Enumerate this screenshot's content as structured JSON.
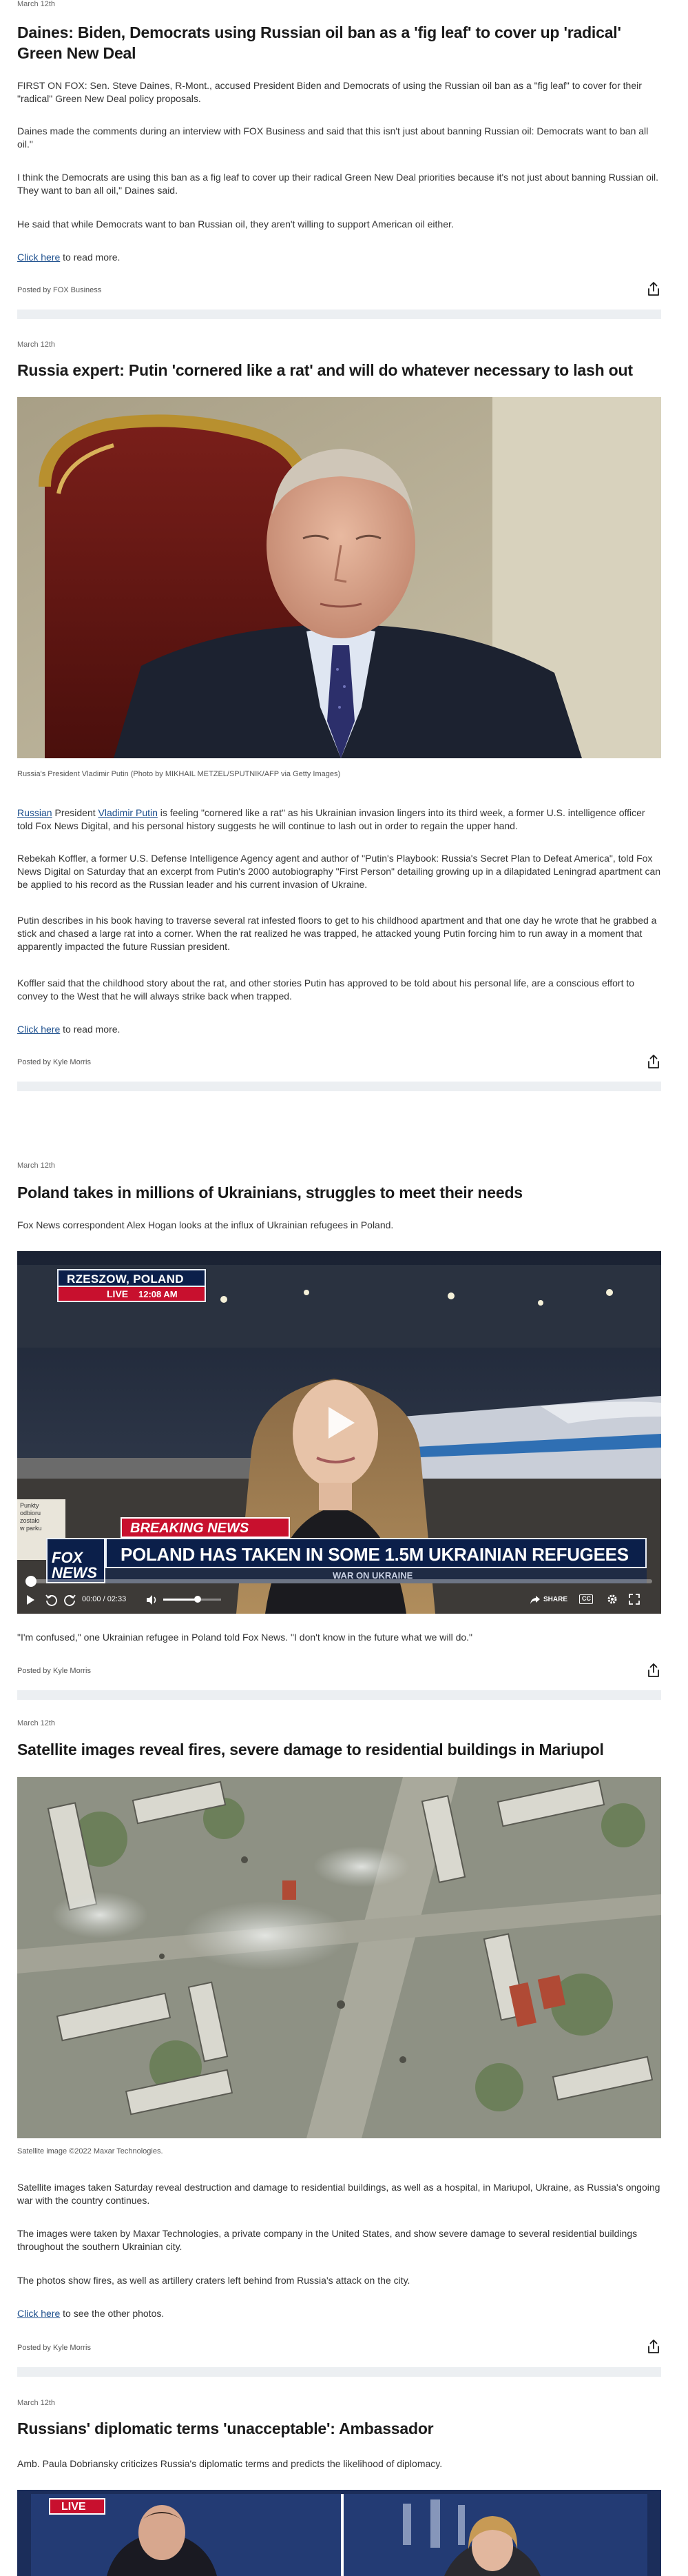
{
  "posts": [
    {
      "date": "March 12th",
      "title": "Daines: Biden, Democrats using Russian oil ban as a 'fig leaf' to cover up 'radical' Green New Deal",
      "paragraphs": [
        "FIRST ON FOX: Sen. Steve Daines, R-Mont., accused President Biden and Democrats of using the Russian oil ban as a \"fig leaf\" to cover for their \"radical\" Green New Deal policy proposals.",
        "Daines made the comments during an interview with FOX Business and said that this isn't just about banning Russian oil: Democrats want to ban all oil.\"",
        "I think the Democrats are using this ban as a fig leaf to cover up their radical Green New Deal priorities because it's not just about banning Russian oil. They want to ban all oil,\" Daines said.",
        "He said that while Democrats want to ban Russian oil, they aren't willing to support American oil either."
      ],
      "read_more_link": "Click here",
      "read_more_text": " to read more.",
      "posted_by": "Posted by FOX Business"
    },
    {
      "date": "March 12th",
      "title": "Russia expert: Putin 'cornered like a rat' and will do whatever necessary to lash out",
      "image_caption": "Russia's President Vladimir Putin (Photo by MIKHAIL METZEL/SPUTNIK/AFP via Getty Images)",
      "p1_link1": "Russian",
      "p1_text1": " President ",
      "p1_link2": "Vladimir Putin",
      "p1_text2": " is feeling \"cornered like a rat\" as his Ukrainian invasion lingers into its third week, a former U.S. intelligence officer told Fox News Digital, and his personal history suggests he will continue to lash out in order to regain the upper hand.",
      "paragraphs": [
        "Rebekah Koffler, a former U.S. Defense Intelligence Agency agent and author of \"Putin's Playbook: Russia's Secret Plan to Defeat America\", told Fox News Digital on Saturday that an excerpt from Putin's 2000 autobiography \"First Person\" detailing growing up in a dilapidated Leningrad apartment can be applied to his record as the Russian leader and his current invasion of Ukraine.",
        "Putin describes in his book having to traverse several rat infested floors to get to his childhood apartment and that one day he wrote that he grabbed a stick and chased a large rat into a corner. When the rat realized he was trapped, he attacked young Putin forcing him to run away in a moment that apparently impacted the future Russian president.",
        "Koffler said that the childhood story about the rat, and other stories Putin has approved to be told about his personal life, are a conscious effort to convey to the West that he will always strike back when trapped."
      ],
      "read_more_link": "Click here",
      "read_more_text": " to read more.",
      "posted_by": "Posted by Kyle Morris"
    },
    {
      "date": "March 12th",
      "title": "Poland takes in millions of Ukrainians, struggles to meet their needs",
      "intro": "Fox News correspondent Alex Hogan looks at the influx of Ukrainian refugees in Poland.",
      "video": {
        "location": "RZESZOW, POLAND",
        "live": "LIVE",
        "time": "12:08 AM",
        "breaking": "BREAKING NEWS",
        "headline": "POLAND HAS TAKEN IN SOME 1.5M UKRAINIAN REFUGEES",
        "subline": "WAR ON UKRAINE",
        "logo": "FOX NEWS",
        "timecode": "00:00 / 02:33",
        "progress": 0.0,
        "volume": 0.6,
        "share": "SHARE",
        "cc": "CC",
        "sign_text": "Punkty\nodbioru\nzostało\nw parku",
        "colors": {
          "red": "#c8102e",
          "navy": "#0b1f4a"
        }
      },
      "quote": "\"I'm confused,\" one Ukrainian refugee in Poland told Fox News. \"I don't know in the future what we will do.\"",
      "posted_by": "Posted by Kyle Morris"
    },
    {
      "date": "March 12th",
      "title": "Satellite images reveal fires, severe damage to residential buildings in Mariupol",
      "image_caption": "Satellite image ©2022 Maxar Technologies.",
      "paragraphs": [
        "Satellite images taken Saturday reveal destruction and damage to residential buildings, as well as a hospital, in Mariupol, Ukraine, as Russia's ongoing war with the country continues.",
        "The images were taken by Maxar Technologies, a private company in the United States, and show severe damage to several residential buildings throughout the southern Ukrainian city.",
        "The photos show fires, as well as artillery craters left behind from Russia's attack on the city."
      ],
      "read_more_link": "Click here",
      "read_more_text": " to see the other photos.",
      "posted_by": "Posted by Kyle Morris"
    },
    {
      "date": "March 12th",
      "title": "Russians' diplomatic terms 'unacceptable': Ambassador",
      "intro": "Amb. Paula Dobriansky criticizes Russia's diplomatic terms and predicts the likelihood of diplomacy.",
      "video_live": "LIVE"
    }
  ],
  "icons": {
    "share": "share-icon",
    "play": "play-icon"
  }
}
